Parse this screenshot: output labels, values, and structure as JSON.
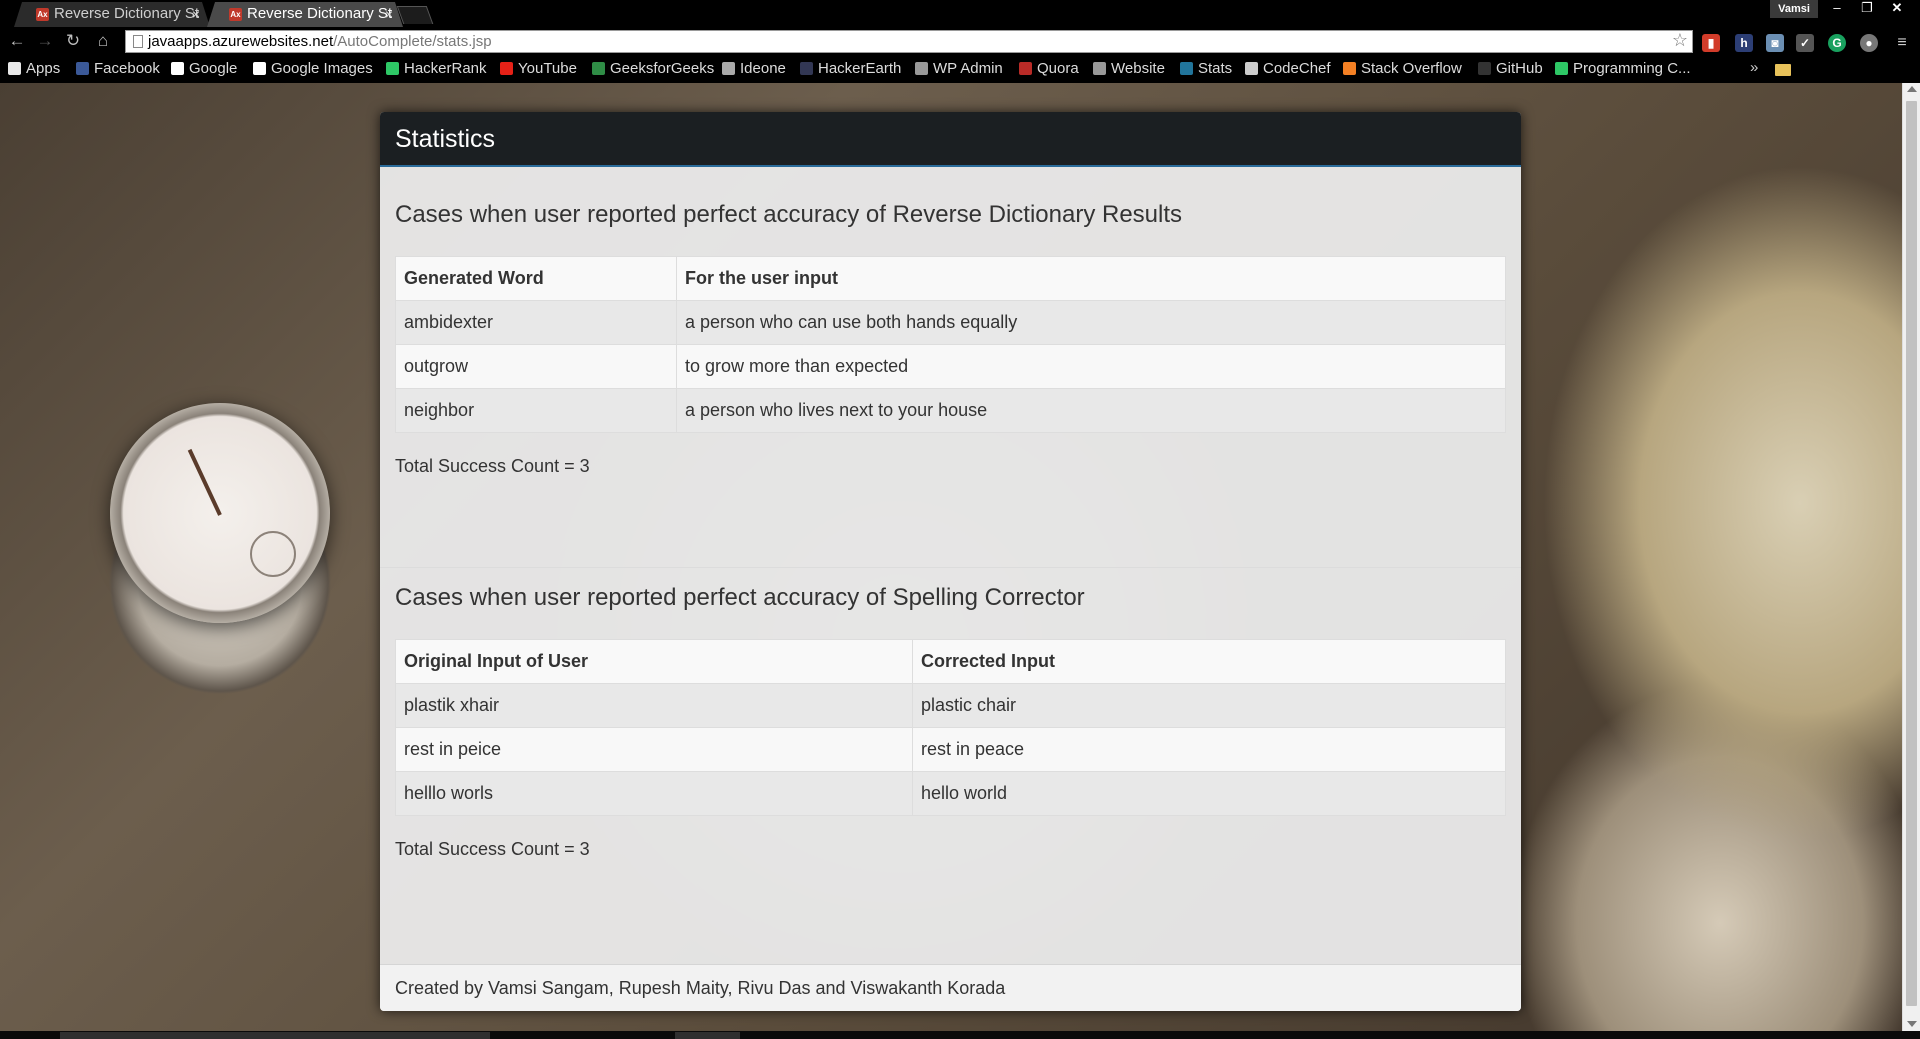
{
  "browser": {
    "tabs": [
      {
        "title": "Reverse Dictionary St",
        "active": false
      },
      {
        "title": "Reverse Dictionary St",
        "active": true
      }
    ],
    "profile": "Vamsi",
    "url_host": "javaapps.azurewebsites.net",
    "url_path": "/AutoComplete/stats.jsp",
    "bookmarks": [
      {
        "label": "Apps",
        "icon": "apps-grid-icon",
        "color": "#e8e8e8"
      },
      {
        "label": "Facebook",
        "icon": "facebook-icon",
        "color": "#3b5998"
      },
      {
        "label": "Google",
        "icon": "google-icon",
        "color": "#ffffff"
      },
      {
        "label": "Google Images",
        "icon": "google-icon",
        "color": "#ffffff"
      },
      {
        "label": "HackerRank",
        "icon": "hackerrank-icon",
        "color": "#2ec866"
      },
      {
        "label": "YouTube",
        "icon": "youtube-icon",
        "color": "#e62117"
      },
      {
        "label": "GeeksforGeeks",
        "icon": "geeksforgeeks-icon",
        "color": "#2f8d46"
      },
      {
        "label": "Ideone",
        "icon": "ideone-icon",
        "color": "#aaaaaa"
      },
      {
        "label": "HackerEarth",
        "icon": "hackerearth-icon",
        "color": "#323754"
      },
      {
        "label": "WP Admin",
        "icon": "wordpress-icon",
        "color": "#999999"
      },
      {
        "label": "Quora",
        "icon": "quora-icon",
        "color": "#b92b27"
      },
      {
        "label": "Website",
        "icon": "wordpress-icon",
        "color": "#999999"
      },
      {
        "label": "Stats",
        "icon": "wordpress-stats-icon",
        "color": "#21759b"
      },
      {
        "label": "CodeChef",
        "icon": "codechef-icon",
        "color": "#cccccc"
      },
      {
        "label": "Stack Overflow",
        "icon": "stackoverflow-icon",
        "color": "#f48024"
      },
      {
        "label": "GitHub",
        "icon": "github-icon",
        "color": "#333333"
      },
      {
        "label": "Programming C...",
        "icon": "hackerrank-icon",
        "color": "#2ec866"
      }
    ],
    "bookmarks_more": "»"
  },
  "page": {
    "heading": "Statistics",
    "sections": [
      {
        "title": "Cases when user reported perfect accuracy of Reverse Dictionary Results",
        "columns": [
          "Generated Word",
          "For the user input"
        ],
        "rows": [
          [
            "ambidexter",
            "a person who can use both hands equally"
          ],
          [
            "outgrow",
            "to grow more than expected"
          ],
          [
            "neighbor",
            "a person who lives next to your house"
          ]
        ],
        "count_label": "Total Success Count = 3"
      },
      {
        "title": "Cases when user reported perfect accuracy of Spelling Corrector",
        "columns": [
          "Original Input of User",
          "Corrected Input"
        ],
        "rows": [
          [
            "plastik xhair",
            "plastic chair"
          ],
          [
            "rest in peice",
            "rest in peace"
          ],
          [
            "helllo worls",
            "hello world"
          ]
        ],
        "count_label": "Total Success Count = 3"
      }
    ],
    "footer": "Created by Vamsi Sangam, Rupesh Maity, Rivu Das and Viswakanth Korada"
  }
}
